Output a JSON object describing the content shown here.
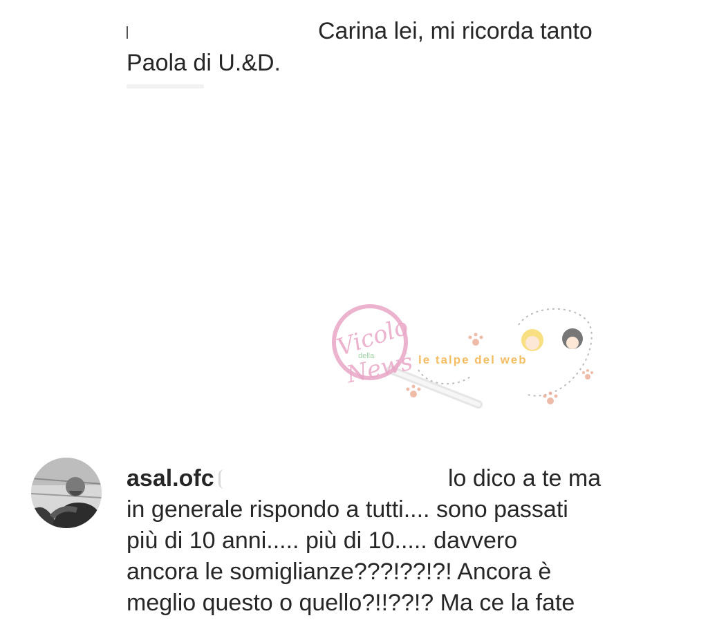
{
  "comment_top": {
    "text_line1": "Carina lei, mi ricorda tanto",
    "text_line2": "Paola di U.&D."
  },
  "watermark": {
    "logo_text_1": "Vicolo",
    "logo_text_2": "della",
    "logo_text_3": "News",
    "tagline": "le talpe del web",
    "colors": {
      "pink": "#e9a6c6",
      "orange": "#f4b24a",
      "paw": "#e79f86"
    }
  },
  "comment_bottom": {
    "username": "asal.ofc",
    "line1_right": "lo dico a te ma",
    "line2": "in generale rispondo a tutti.... sono passati",
    "line3": "più di 10 anni..... più di 10..... davvero",
    "line4": "ancora le somiglianze???!??!?! Ancora è",
    "line5": "meglio questo o quello?!!??!? Ma ce la fate"
  }
}
